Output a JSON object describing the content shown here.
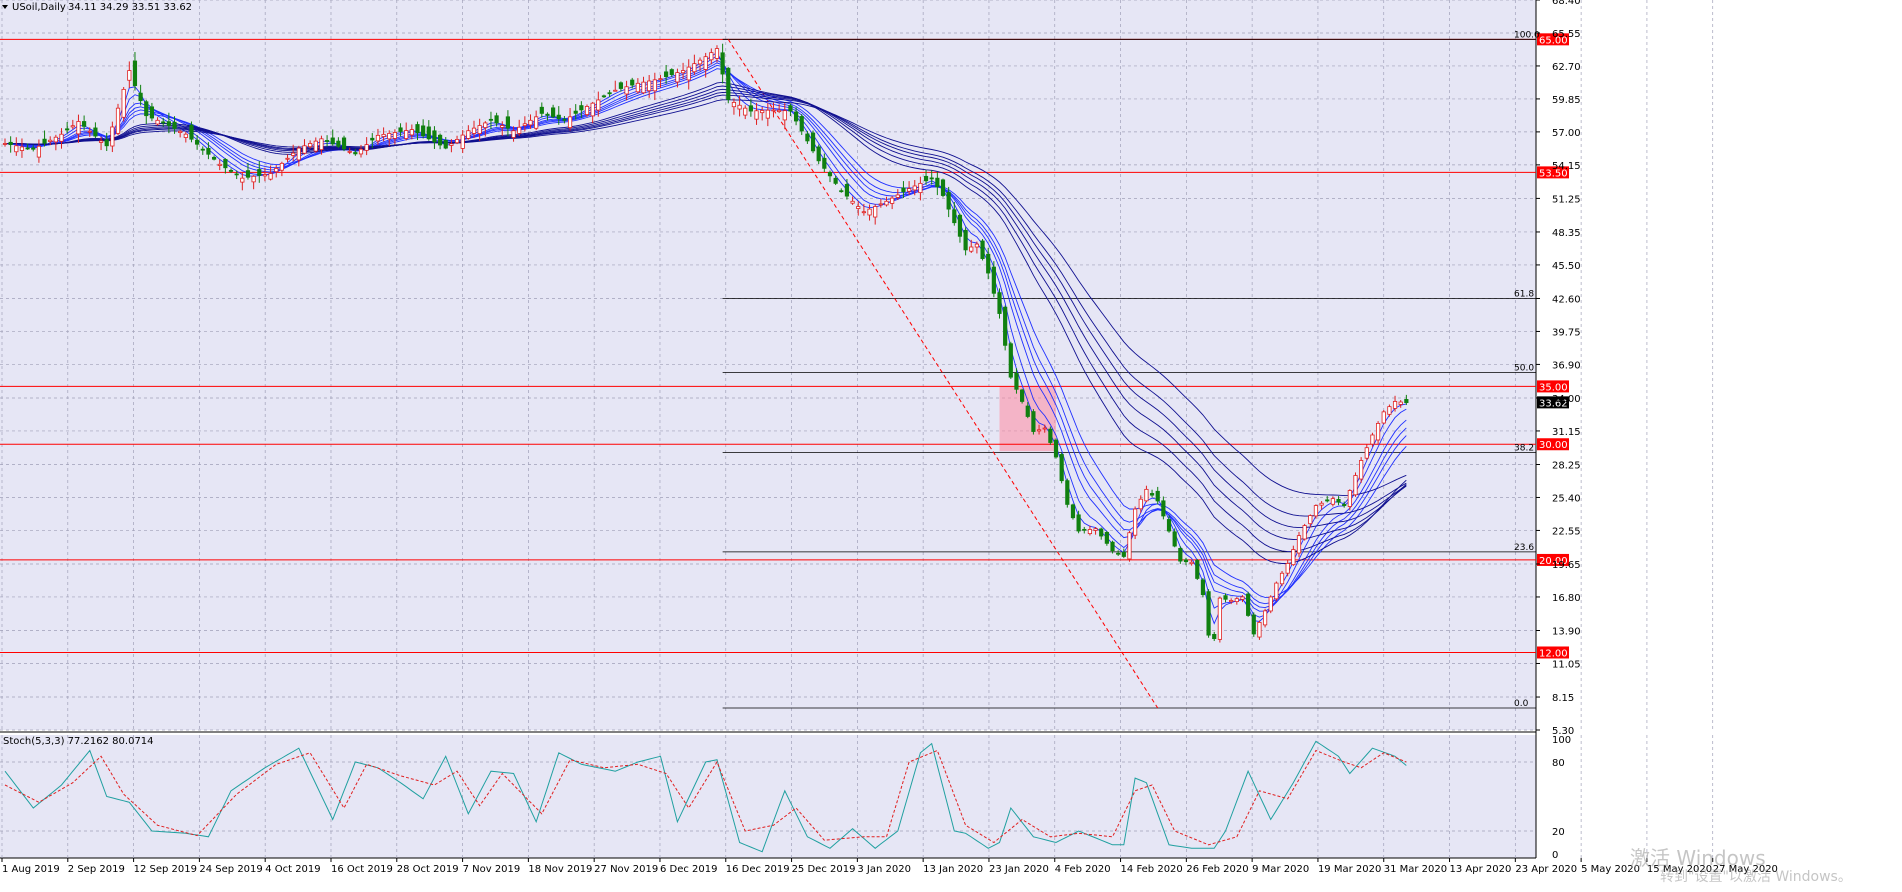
{
  "header": {
    "symbol_label": "USoil,Daily",
    "ohlc": "34.11 34.29 33.51 33.62",
    "stoch_label": "Stoch(5,3,3) 77.2162 80.0714"
  },
  "watermark": {
    "line1": "激活 Windows",
    "line2": "转到\"设置\"以激活 Windows。"
  },
  "colors": {
    "background": "#e6e6f5",
    "grid": "#a0a0b8",
    "bull": "#e02020",
    "bear": "#108010",
    "ribbon": "#1010c0",
    "level": "#ff0000",
    "fib": "#000000",
    "stoch_main": "#20a0a0",
    "stoch_signal": "#e02020"
  },
  "chart_data": {
    "type": "candlestick",
    "title": "USoil,Daily",
    "x_tick_labels": [
      "1 Aug 2019",
      "2 Sep 2019",
      "12 Sep 2019",
      "24 Sep 2019",
      "4 Oct 2019",
      "16 Oct 2019",
      "28 Oct 2019",
      "7 Nov 2019",
      "18 Nov 2019",
      "27 Nov 2019",
      "6 Dec 2019",
      "16 Dec 2019",
      "25 Dec 2019",
      "3 Jan 2020",
      "13 Jan 2020",
      "23 Jan 2020",
      "4 Feb 2020",
      "14 Feb 2020",
      "26 Feb 2020",
      "9 Mar 2020",
      "19 Mar 2020",
      "31 Mar 2020",
      "13 Apr 2020",
      "23 Apr 2020",
      "5 May 2020",
      "15 May 2020",
      "27 May 2020"
    ],
    "y_tick_labels": [
      "68.40",
      "65.55",
      "62.70",
      "59.85",
      "57.00",
      "54.15",
      "51.25",
      "48.35",
      "45.50",
      "42.60",
      "39.75",
      "36.90",
      "34.00",
      "31.15",
      "28.25",
      "25.40",
      "22.55",
      "19.65",
      "16.80",
      "13.90",
      "11.05",
      "8.15",
      "5.30"
    ],
    "ylim": [
      5.3,
      68.4
    ],
    "close_path": [
      [
        0,
        56.0
      ],
      [
        5,
        55.5
      ],
      [
        10,
        56.8
      ],
      [
        13,
        57.9
      ],
      [
        18,
        55.8
      ],
      [
        22,
        62.3
      ],
      [
        25,
        58.4
      ],
      [
        28,
        57.8
      ],
      [
        32,
        56.8
      ],
      [
        38,
        54.2
      ],
      [
        42,
        53.0
      ],
      [
        47,
        53.4
      ],
      [
        52,
        55.6
      ],
      [
        56,
        56.4
      ],
      [
        62,
        55.1
      ],
      [
        66,
        56.7
      ],
      [
        72,
        57.2
      ],
      [
        78,
        55.6
      ],
      [
        82,
        57.1
      ],
      [
        86,
        58.0
      ],
      [
        90,
        57.1
      ],
      [
        95,
        58.6
      ],
      [
        99,
        58.0
      ],
      [
        103,
        59.2
      ],
      [
        108,
        60.6
      ],
      [
        112,
        61.2
      ],
      [
        116,
        61.6
      ],
      [
        120,
        62.3
      ],
      [
        124,
        63.5
      ],
      [
        126,
        64.2
      ],
      [
        128,
        59.8
      ],
      [
        132,
        58.8
      ],
      [
        136,
        58.9
      ],
      [
        139,
        58.8
      ],
      [
        144,
        54.5
      ],
      [
        148,
        51.9
      ],
      [
        152,
        50.1
      ],
      [
        156,
        51.0
      ],
      [
        160,
        52.1
      ],
      [
        164,
        53.0
      ],
      [
        166,
        51.5
      ],
      [
        170,
        46.8
      ],
      [
        172,
        47.3
      ],
      [
        174,
        44.8
      ],
      [
        176,
        41.3
      ],
      [
        178,
        35.8
      ],
      [
        180,
        33.7
      ],
      [
        182,
        31.1
      ],
      [
        184,
        31.4
      ],
      [
        186,
        28.9
      ],
      [
        188,
        24.8
      ],
      [
        190,
        22.5
      ],
      [
        193,
        22.7
      ],
      [
        196,
        20.8
      ],
      [
        198,
        20.3
      ],
      [
        200,
        24.4
      ],
      [
        202,
        26.1
      ],
      [
        204,
        25.1
      ],
      [
        206,
        22.5
      ],
      [
        208,
        19.9
      ],
      [
        210,
        19.8
      ],
      [
        212,
        17.0
      ],
      [
        213,
        13.5
      ],
      [
        214,
        13.2
      ],
      [
        215,
        16.7
      ],
      [
        217,
        16.5
      ],
      [
        219,
        16.8
      ],
      [
        221,
        13.6
      ],
      [
        223,
        15.6
      ],
      [
        225,
        18.0
      ],
      [
        227,
        19.7
      ],
      [
        229,
        22.1
      ],
      [
        232,
        24.7
      ],
      [
        235,
        25.3
      ],
      [
        237,
        24.7
      ],
      [
        240,
        28.6
      ],
      [
        242,
        30.8
      ],
      [
        244,
        32.8
      ],
      [
        246,
        33.7
      ],
      [
        248,
        33.6
      ]
    ],
    "price_levels": [
      65.0,
      53.5,
      35.0,
      30.0,
      20.0,
      12.0
    ],
    "current_price": 33.62,
    "fib_levels": [
      {
        "label": "100.0",
        "price": 65.0
      },
      {
        "label": "61.8",
        "price": 42.6
      },
      {
        "label": "50.0",
        "price": 36.2
      },
      {
        "label": "38.2",
        "price": 29.3
      },
      {
        "label": "23.6",
        "price": 20.7
      },
      {
        "label": "0.0",
        "price": 7.2
      }
    ],
    "stochastic": {
      "ylim": [
        0,
        100
      ],
      "y_tick_labels": [
        "100",
        "80",
        "20",
        "0"
      ],
      "k_path": [
        [
          0,
          72
        ],
        [
          5,
          40
        ],
        [
          10,
          60
        ],
        [
          15,
          90
        ],
        [
          18,
          50
        ],
        [
          22,
          45
        ],
        [
          26,
          20
        ],
        [
          32,
          18
        ],
        [
          36,
          15
        ],
        [
          40,
          55
        ],
        [
          46,
          75
        ],
        [
          52,
          92
        ],
        [
          58,
          30
        ],
        [
          62,
          80
        ],
        [
          66,
          75
        ],
        [
          70,
          62
        ],
        [
          74,
          48
        ],
        [
          78,
          85
        ],
        [
          82,
          35
        ],
        [
          86,
          72
        ],
        [
          90,
          70
        ],
        [
          94,
          28
        ],
        [
          98,
          88
        ],
        [
          102,
          78
        ],
        [
          108,
          72
        ],
        [
          112,
          80
        ],
        [
          116,
          85
        ],
        [
          119,
          28
        ],
        [
          124,
          80
        ],
        [
          126,
          82
        ],
        [
          130,
          10
        ],
        [
          134,
          2
        ],
        [
          138,
          55
        ],
        [
          142,
          15
        ],
        [
          146,
          5
        ],
        [
          150,
          22
        ],
        [
          154,
          5
        ],
        [
          158,
          20
        ],
        [
          162,
          88
        ],
        [
          164,
          96
        ],
        [
          168,
          20
        ],
        [
          170,
          18
        ],
        [
          174,
          5
        ],
        [
          176,
          10
        ],
        [
          178,
          40
        ],
        [
          182,
          15
        ],
        [
          186,
          10
        ],
        [
          190,
          20
        ],
        [
          196,
          8
        ],
        [
          198,
          8
        ],
        [
          200,
          66
        ],
        [
          202,
          62
        ],
        [
          206,
          8
        ],
        [
          210,
          5
        ],
        [
          214,
          5
        ],
        [
          216,
          20
        ],
        [
          220,
          72
        ],
        [
          224,
          30
        ],
        [
          228,
          62
        ],
        [
          232,
          98
        ],
        [
          236,
          85
        ],
        [
          238,
          70
        ],
        [
          242,
          92
        ],
        [
          246,
          85
        ],
        [
          248,
          77
        ]
      ],
      "d_path": [
        [
          0,
          60
        ],
        [
          6,
          45
        ],
        [
          12,
          62
        ],
        [
          17,
          85
        ],
        [
          21,
          52
        ],
        [
          27,
          25
        ],
        [
          34,
          16
        ],
        [
          41,
          52
        ],
        [
          48,
          78
        ],
        [
          54,
          88
        ],
        [
          60,
          40
        ],
        [
          64,
          78
        ],
        [
          70,
          68
        ],
        [
          76,
          60
        ],
        [
          80,
          72
        ],
        [
          84,
          42
        ],
        [
          88,
          70
        ],
        [
          95,
          35
        ],
        [
          100,
          82
        ],
        [
          106,
          75
        ],
        [
          112,
          78
        ],
        [
          117,
          70
        ],
        [
          121,
          40
        ],
        [
          126,
          80
        ],
        [
          131,
          20
        ],
        [
          136,
          25
        ],
        [
          140,
          40
        ],
        [
          145,
          12
        ],
        [
          152,
          15
        ],
        [
          156,
          15
        ],
        [
          160,
          80
        ],
        [
          165,
          90
        ],
        [
          170,
          25
        ],
        [
          175,
          10
        ],
        [
          180,
          30
        ],
        [
          185,
          15
        ],
        [
          190,
          18
        ],
        [
          196,
          15
        ],
        [
          200,
          55
        ],
        [
          203,
          60
        ],
        [
          207,
          20
        ],
        [
          213,
          8
        ],
        [
          218,
          15
        ],
        [
          222,
          55
        ],
        [
          227,
          48
        ],
        [
          232,
          90
        ],
        [
          237,
          80
        ],
        [
          240,
          75
        ],
        [
          244,
          88
        ],
        [
          248,
          80
        ]
      ]
    }
  }
}
